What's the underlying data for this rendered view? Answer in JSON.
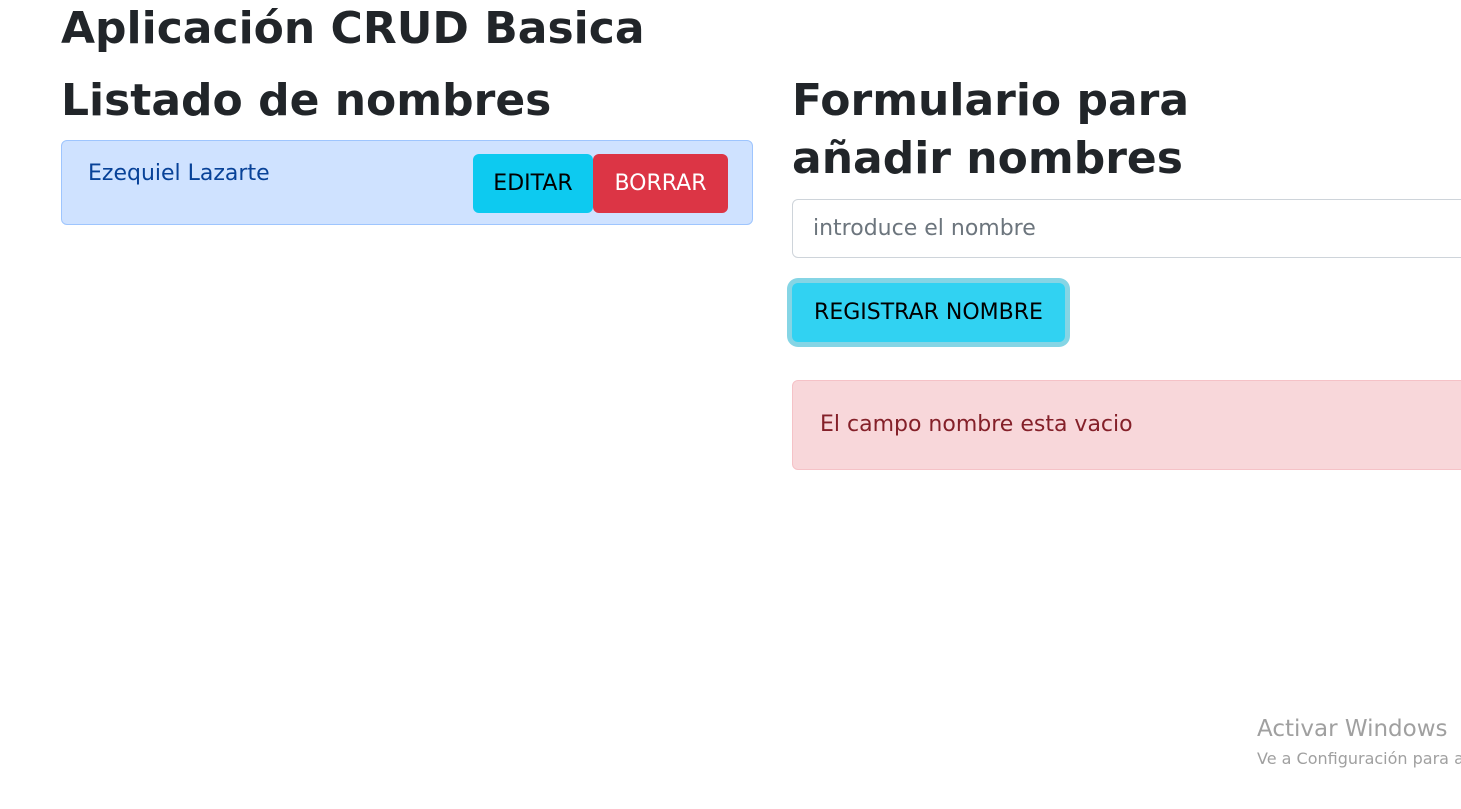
{
  "app": {
    "title": "Aplicación CRUD Basica"
  },
  "list": {
    "title": "Listado de nombres",
    "items": [
      {
        "name": "Ezequiel Lazarte",
        "edit_label": "EDITAR",
        "delete_label": "BORRAR"
      }
    ]
  },
  "form": {
    "title": "Formulario para añadir nombres",
    "input_placeholder": "introduce el nombre",
    "input_value": "",
    "submit_label": "REGISTRAR NOMBRE",
    "error_message": "El campo nombre esta vacio"
  },
  "os_watermark": {
    "title": "Activar Windows",
    "subtitle": "Ve a Configuración para a"
  },
  "colors": {
    "list_item_bg": "#cfe2ff",
    "list_item_text": "#084298",
    "edit_button": "#0dcaf0",
    "delete_button": "#dc3545",
    "register_button": "#31d2f2",
    "alert_bg": "#f8d7da",
    "alert_text": "#842029"
  }
}
